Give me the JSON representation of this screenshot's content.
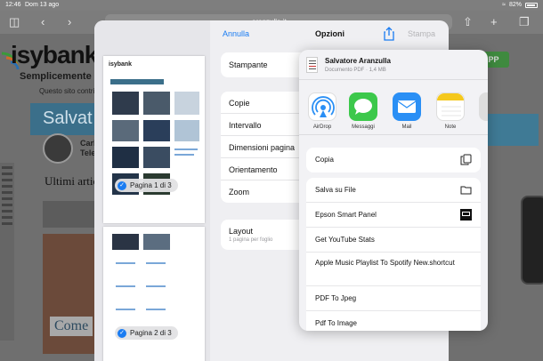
{
  "status_bar": {
    "time": "12:46",
    "date": "Dom 13 ago",
    "battery": "82%"
  },
  "browser": {
    "url": "aranzulla.it"
  },
  "webpage": {
    "logo_text": "isybank",
    "tagline": "Semplicemente b",
    "notice": "Questo sito contri",
    "banner_text": "Salvat",
    "author": "Carl\nTele",
    "section_title": "Ultimi artic",
    "feature_text": "Come",
    "right_button": "APP"
  },
  "print_options": {
    "cancel_label": "Annulla",
    "title": "Opzioni",
    "print_label": "Stampa",
    "printer_label": "Stampante",
    "rows": [
      {
        "label": "Copie"
      },
      {
        "label": "Intervallo"
      },
      {
        "label": "Dimensioni pagina"
      },
      {
        "label": "Orientamento"
      },
      {
        "label": "Zoom"
      }
    ],
    "layout": {
      "label": "Layout",
      "sub": "1 pagina per foglio"
    },
    "pages": [
      {
        "badge": "Pagina 1 di 3"
      },
      {
        "badge": "Pagina 2 di 3"
      }
    ]
  },
  "share_sheet": {
    "title": "Salvatore Aranzulla",
    "subtitle": "Documento PDF · 1,4 MB",
    "apps": [
      {
        "label": "AirDrop",
        "icon": "airdrop-icon"
      },
      {
        "label": "Messaggi",
        "icon": "messages-icon"
      },
      {
        "label": "Mail",
        "icon": "mail-icon"
      },
      {
        "label": "Note",
        "icon": "notes-icon"
      }
    ],
    "copy_label": "Copia",
    "actions": [
      {
        "label": "Salva su File",
        "icon": "folder-icon"
      },
      {
        "label": "Epson Smart Panel",
        "icon": "epson-icon"
      },
      {
        "label": "Get YouTube Stats"
      },
      {
        "label": "Apple Music Playlist To Spotify New.shortcut"
      },
      {
        "label": "PDF To Jpeg"
      },
      {
        "label": "Pdf To Image"
      }
    ]
  }
}
